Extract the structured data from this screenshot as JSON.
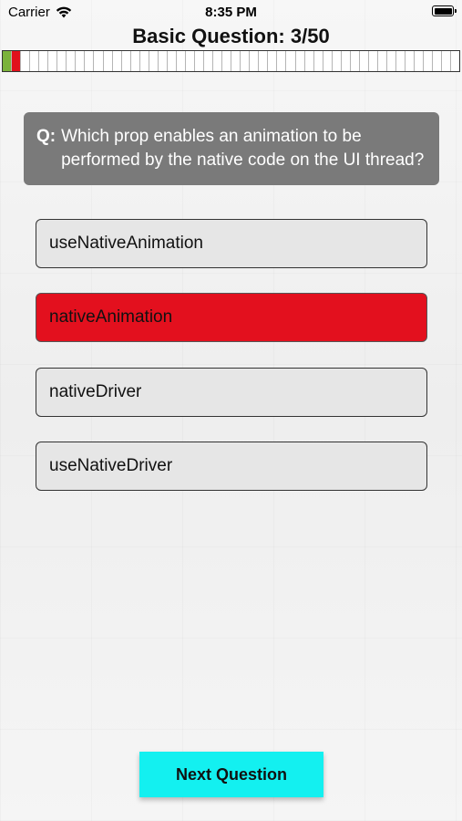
{
  "status_bar": {
    "carrier": "Carrier",
    "time": "8:35 PM",
    "wifi_icon": "wifi-icon",
    "battery_icon": "battery-icon"
  },
  "header": {
    "title": "Basic Question: 3/50"
  },
  "progress": {
    "total_segments": 50,
    "answered_correct": [
      1
    ],
    "answered_wrong": [
      2
    ],
    "colors": {
      "correct": "#7bb23a",
      "wrong": "#e0101c",
      "empty": "#ffffff"
    }
  },
  "question": {
    "prefix": "Q:",
    "text": "Which prop enables an animation to be performed by the native code on the UI thread?"
  },
  "answers": [
    {
      "label": "useNativeAnimation",
      "state": "default"
    },
    {
      "label": "nativeAnimation",
      "state": "selected-wrong"
    },
    {
      "label": "nativeDriver",
      "state": "default"
    },
    {
      "label": "useNativeDriver",
      "state": "default"
    }
  ],
  "next_button": {
    "label": "Next Question",
    "color": "#13f0f0"
  }
}
